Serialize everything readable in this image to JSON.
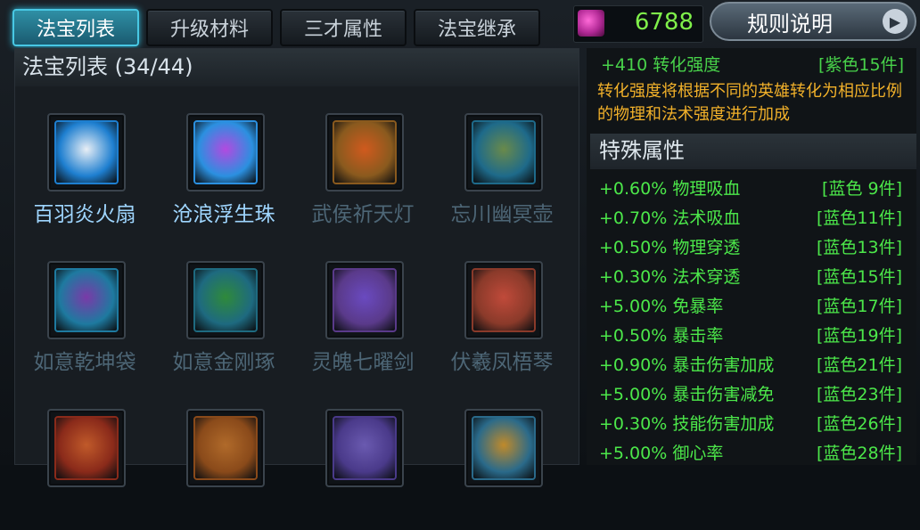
{
  "tabs": [
    {
      "label": "法宝列表",
      "active": true
    },
    {
      "label": "升级材料",
      "active": false
    },
    {
      "label": "三才属性",
      "active": false
    },
    {
      "label": "法宝继承",
      "active": false
    }
  ],
  "currency": {
    "icon": "gem-icon",
    "value": "6788"
  },
  "rules_button": {
    "label": "规则说明",
    "icon": "arrow-right-icon"
  },
  "treasure_list": {
    "title": "法宝列表 (34/44)",
    "items": [
      {
        "name": "百羽炎火扇",
        "owned": true,
        "icon": "feather-fan-icon",
        "frame_color": "#1e7fd0",
        "fill": "#e8eef5"
      },
      {
        "name": "沧浪浮生珠",
        "owned": true,
        "icon": "pearl-icon",
        "frame_color": "#2b90e0",
        "fill": "#b24ae0"
      },
      {
        "name": "武侯祈天灯",
        "owned": false,
        "icon": "lantern-icon",
        "frame_color": "#8a5a1e",
        "fill": "#d05a1e"
      },
      {
        "name": "忘川幽冥壶",
        "owned": false,
        "icon": "jar-icon",
        "frame_color": "#1e6a8a",
        "fill": "#6a8a4a"
      },
      {
        "name": "如意乾坤袋",
        "owned": false,
        "icon": "bag-icon",
        "frame_color": "#1e7aa0",
        "fill": "#7a3aa8"
      },
      {
        "name": "如意金刚琢",
        "owned": false,
        "icon": "ring-icon",
        "frame_color": "#1e6a80",
        "fill": "#2f8a3a"
      },
      {
        "name": "灵魄七曜剑",
        "owned": false,
        "icon": "swords-icon",
        "frame_color": "#5a3a8a",
        "fill": "#6a4ac0"
      },
      {
        "name": "伏羲凤梧琴",
        "owned": false,
        "icon": "zither-icon",
        "frame_color": "#8a3a2a",
        "fill": "#c04a3a"
      },
      {
        "name": "",
        "owned": false,
        "icon": "dragon-icon",
        "frame_color": "#8a2a1a",
        "fill": "#c05a2a"
      },
      {
        "name": "",
        "owned": false,
        "icon": "armor-icon",
        "frame_color": "#8a4a1a",
        "fill": "#b06a2a"
      },
      {
        "name": "",
        "owned": false,
        "icon": "mirror-icon",
        "frame_color": "#4a3a8a",
        "fill": "#6a5ab0"
      },
      {
        "name": "",
        "owned": false,
        "icon": "crown-icon",
        "frame_color": "#2a6a8a",
        "fill": "#c08a2a"
      }
    ]
  },
  "conversion": {
    "value": "+410 转化强度",
    "tag": "[紫色15件]",
    "description": "转化强度将根据不同的英雄转化为相应比例的物理和法术强度进行加成"
  },
  "special_attributes": {
    "title": "特殊属性",
    "items": [
      {
        "value": "+0.60%",
        "name": "物理吸血",
        "tag": "[蓝色 9件]"
      },
      {
        "value": "+0.70%",
        "name": "法术吸血",
        "tag": "[蓝色11件]"
      },
      {
        "value": "+0.50%",
        "name": "物理穿透",
        "tag": "[蓝色13件]"
      },
      {
        "value": "+0.30%",
        "name": "法术穿透",
        "tag": "[蓝色15件]"
      },
      {
        "value": "+5.00%",
        "name": "免暴率",
        "tag": "[蓝色17件]"
      },
      {
        "value": "+0.50%",
        "name": "暴击率",
        "tag": "[蓝色19件]"
      },
      {
        "value": "+0.90%",
        "name": "暴击伤害加成",
        "tag": "[蓝色21件]"
      },
      {
        "value": "+5.00%",
        "name": "暴击伤害减免",
        "tag": "[蓝色23件]"
      },
      {
        "value": "+0.30%",
        "name": "技能伤害加成",
        "tag": "[蓝色26件]"
      },
      {
        "value": "+5.00%",
        "name": "御心率",
        "tag": "[蓝色28件]"
      }
    ]
  }
}
